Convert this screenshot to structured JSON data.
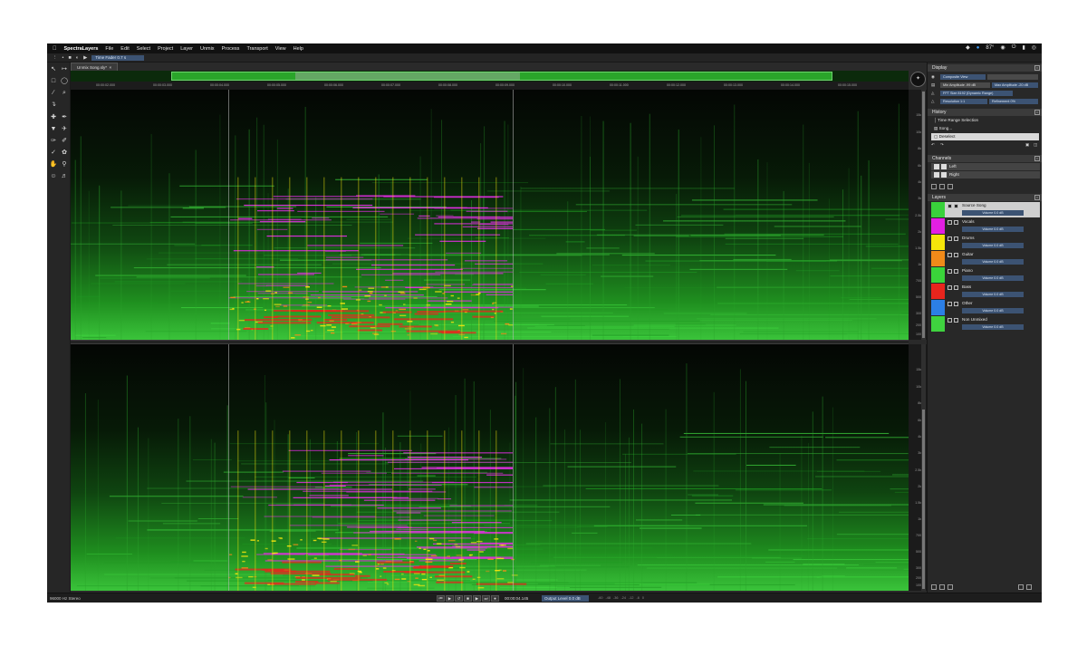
{
  "menubar": {
    "app_name": "SpectraLayers",
    "items": [
      "File",
      "Edit",
      "Select",
      "Project",
      "Layer",
      "Unmix",
      "Process",
      "Transport",
      "View",
      "Help"
    ],
    "status_temp": "87°"
  },
  "toolbar": {
    "tool_field": "Time Fader 0.7 s"
  },
  "tabs": [
    {
      "label": "Unmix Song.sly*"
    }
  ],
  "ruler": {
    "labels": [
      "00:00:02.000",
      "00:00:03.000",
      "00:00:04.000",
      "00:00:05.000",
      "00:00:06.000",
      "00:00:07.000",
      "00:00:08.000",
      "00:00:09.000",
      "00:00:10.000",
      "00:00:11.000",
      "00:00:12.000",
      "00:00:13.000",
      "00:00:14.000",
      "00:00:15.000"
    ]
  },
  "freq_scale": {
    "labels": [
      "15k",
      "10k",
      "8k",
      "6k",
      "4k",
      "3k",
      "2.5k",
      "2k",
      "1.5k",
      "1k",
      "700",
      "500",
      "300",
      "200",
      "100"
    ]
  },
  "panels": {
    "display": {
      "title": "Display",
      "mode": "Composite View",
      "min_amplitude": "Min Amplitude -99 dB",
      "max_amplitude": "Max Amplitude -20 dB",
      "fft": "FFT Size 8192 (Dynamic Range)",
      "resolution": "Resolution 1:1",
      "refinement": "Refinement 0%"
    },
    "history": {
      "title": "History",
      "items": [
        "Time Range Selection",
        "Song...",
        "Deselect"
      ],
      "selected_index": 2
    },
    "channels": {
      "title": "Channels",
      "items": [
        "Left",
        "Right"
      ]
    },
    "layers": {
      "title": "Layers",
      "volume_label": "Volume 0.0 dB",
      "items": [
        {
          "name": "Source Song",
          "color": "#39d13b",
          "selected": true
        },
        {
          "name": "Vocals",
          "color": "#e31fe3",
          "selected": false
        },
        {
          "name": "Drums",
          "color": "#f5e60a",
          "selected": false
        },
        {
          "name": "Guitar",
          "color": "#f08a19",
          "selected": false
        },
        {
          "name": "Piano",
          "color": "#3ad43a",
          "selected": false
        },
        {
          "name": "Bass",
          "color": "#e8251d",
          "selected": false
        },
        {
          "name": "Other",
          "color": "#2c7fe6",
          "selected": false
        },
        {
          "name": "Non Unmixed",
          "color": "#3fd33f",
          "selected": false
        }
      ]
    }
  },
  "bottombar": {
    "status": "96000 Hz Stereo",
    "timecode": "00:00:04.145",
    "output_level": "Output Level 0.0 dB"
  }
}
